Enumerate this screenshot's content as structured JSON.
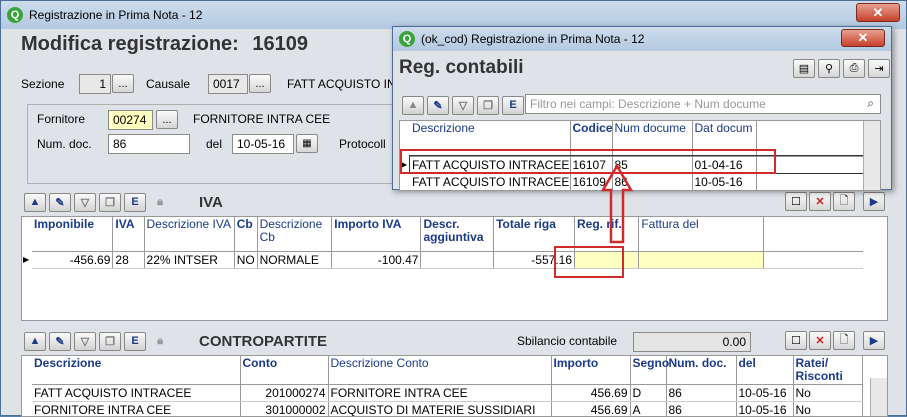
{
  "main": {
    "window_title": "Registrazione in Prima Nota - 12",
    "close_glyph": "✕",
    "heading_label": "Modifica registrazione:",
    "heading_number": "16109",
    "sezione_label": "Sezione",
    "sezione_value": "1",
    "causale_label": "Causale",
    "causale_value": "0017",
    "causale_desc": "FATT ACQUISTO IN",
    "fornitore_label": "Fornitore",
    "fornitore_code": "00274",
    "fornitore_name": "FORNITORE INTRA CEE",
    "numdoc_label": "Num. doc.",
    "numdoc_value": "86",
    "del_label": "del",
    "del_value": "10-05-16",
    "protocollo_label": "Protocoll",
    "ellipsis": "..."
  },
  "iva": {
    "title": "IVA",
    "columns": [
      "Imponibile",
      "IVA",
      "Descrizione IVA",
      "Cb",
      "Descrizione Cb",
      "Importo IVA",
      "Descr. aggiuntiva",
      "Totale riga",
      "Reg. rif.",
      "Fattura del"
    ],
    "rows": [
      [
        "-456.69",
        "28",
        "22% INTSER",
        "NO",
        "NORMALE",
        "-100.47",
        "",
        "-557.16",
        "",
        ""
      ]
    ]
  },
  "contropartite": {
    "title": "CONTROPARTITE",
    "sbilancio_label": "Sbilancio contabile",
    "sbilancio_value": "0.00",
    "columns": [
      "Descrizione",
      "Conto",
      "Descrizione Conto",
      "Importo",
      "Segno",
      "Num. doc.",
      "del",
      "Ratei/ Risconti"
    ],
    "rows": [
      [
        "FATT ACQUISTO INTRACEE",
        "201000274",
        "FORNITORE INTRA CEE",
        "456.69",
        "D",
        "86",
        "10-05-16",
        "No"
      ],
      [
        "FORNITORE INTRA CEE",
        "301000002",
        "ACQUISTO DI MATERIE SUSSIDIARI",
        "456.69",
        "A",
        "86",
        "10-05-16",
        "No"
      ]
    ]
  },
  "popup": {
    "window_title": "(ok_cod) Registrazione in Prima Nota - 12",
    "close_glyph": "✕",
    "heading": "Reg. contabili",
    "filter_placeholder": "Filtro nei campi: Descrizione + Num docume",
    "columns": [
      "Descrizione",
      "Codice",
      "Num docume",
      "Dat docum"
    ],
    "rows": [
      [
        "FATT ACQUISTO INTRACEE",
        "16107",
        "85",
        "01-04-16"
      ],
      [
        "FATT ACQUISTO INTRACEE",
        "16109",
        "86",
        "10-05-16"
      ]
    ],
    "current_row_marker": "▶"
  },
  "colors": {
    "header_text": "#1a3a8a",
    "highlight_yellow": "#ffffc0",
    "annotation_red": "#d12a2a",
    "titlebar": "#c2d5ea"
  }
}
